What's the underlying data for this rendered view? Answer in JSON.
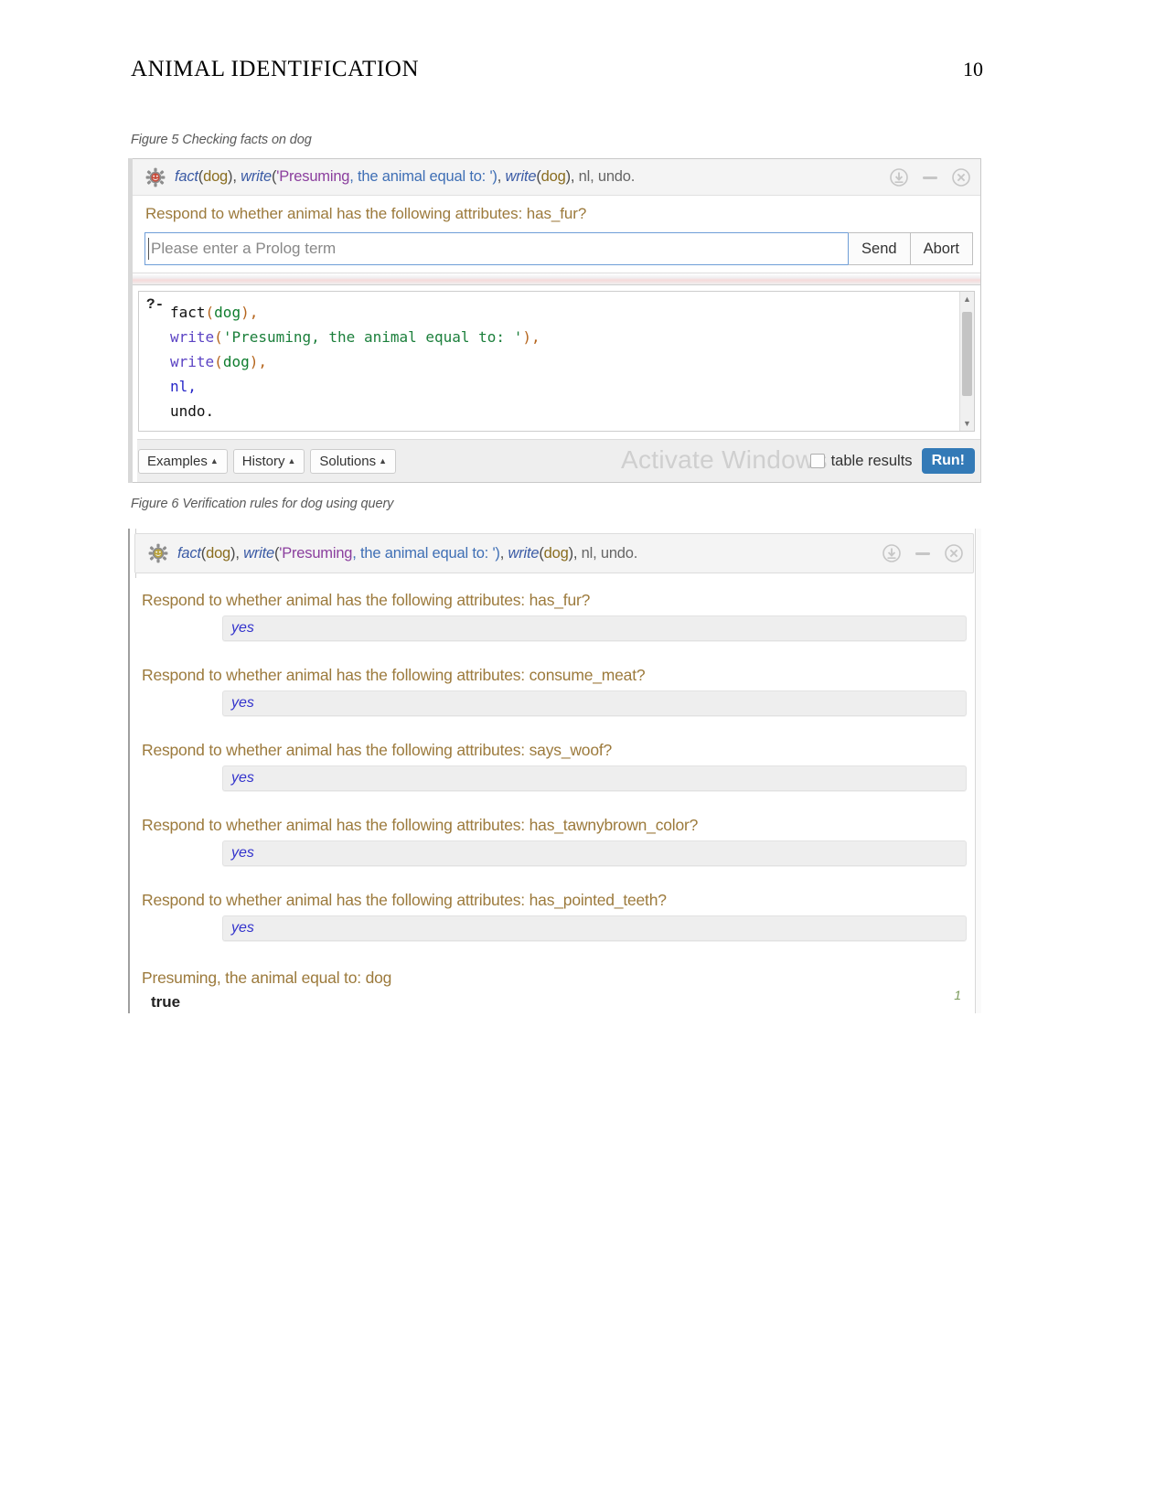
{
  "document": {
    "header_title": "ANIMAL IDENTIFICATION",
    "page_number": "10",
    "caption_fig5": "Figure 5 Checking facts on dog",
    "caption_fig6": "Figure 6 Verification rules for dog using query"
  },
  "query_title": {
    "icon": "swish-gear-icon",
    "p1_func": "fact",
    "p1_open": "(",
    "p1_arg": "dog",
    "p1_close": "), ",
    "p2_func": "write",
    "p2_open": "(",
    "p2_str": "'Presuming",
    "p2_str_rest": ", the animal equal to: ')",
    "p2_close": ", ",
    "p3_func": "write",
    "p3_open": "(",
    "p3_arg": "dog",
    "p3_close": "), ",
    "p4": "nl, undo.",
    "full_text": "fact(dog), write('Presuming, the animal equal to: '), write(dog), nl, undo."
  },
  "window_controls": {
    "download": "download-icon",
    "minimize": "minimize-icon",
    "close": "close-icon"
  },
  "fig5": {
    "ask_line": "Respond to whether animal has the following attributes: has_fur?",
    "input_placeholder": "Please enter a Prolog term",
    "input_value": "",
    "send_label": "Send",
    "abort_label": "Abort",
    "editor": {
      "prompt": "?-",
      "lines": [
        {
          "parts": [
            {
              "t": "fact",
              "c": "plain"
            },
            {
              "t": "(",
              "c": "paren"
            },
            {
              "t": "dog",
              "c": "arg"
            },
            {
              "t": "),",
              "c": "paren"
            }
          ]
        },
        {
          "parts": [
            {
              "t": "write",
              "c": "write"
            },
            {
              "t": "(",
              "c": "paren"
            },
            {
              "t": "'Presuming, the animal equal to: '",
              "c": "str"
            },
            {
              "t": "),",
              "c": "paren"
            }
          ]
        },
        {
          "parts": [
            {
              "t": "write",
              "c": "write"
            },
            {
              "t": "(",
              "c": "paren"
            },
            {
              "t": "dog",
              "c": "arg"
            },
            {
              "t": "),",
              "c": "paren"
            }
          ]
        },
        {
          "parts": [
            {
              "t": "nl",
              "c": "nl"
            },
            {
              "t": ",",
              "c": "plain"
            }
          ]
        },
        {
          "parts": [
            {
              "t": "undo.",
              "c": "plain"
            }
          ]
        }
      ],
      "line1": "fact(dog),",
      "line2": "write('Presuming, the animal equal to: '),",
      "line3": "write(dog),",
      "line4": "nl,",
      "line5": "undo."
    },
    "toolbar": {
      "examples_label": "Examples",
      "history_label": "History",
      "solutions_label": "Solutions",
      "caret": "▲",
      "table_results_label": "table results",
      "table_results_checked": false,
      "run_label": "Run!"
    },
    "watermark": "Activate Windows"
  },
  "fig6": {
    "qa": [
      {
        "question": "Respond to whether animal has the following attributes: has_fur?",
        "answer": "yes"
      },
      {
        "question": "Respond to whether animal has the following attributes: consume_meat?",
        "answer": "yes"
      },
      {
        "question": "Respond to whether animal has the following attributes: says_woof?",
        "answer": "yes"
      },
      {
        "question": "Respond to whether animal has the following attributes: has_tawnybrown_color?",
        "answer": "yes"
      },
      {
        "question": "Respond to whether animal has the following attributes: has_pointed_teeth?",
        "answer": "yes"
      }
    ],
    "conclusion": "Presuming, the animal equal to: dog",
    "status": "true",
    "answer_count": "1"
  },
  "colors": {
    "accent_blue": "#337ab7",
    "prompt_brown": "#9c7a3c",
    "answer_blue": "#3333cc",
    "watermark_gray": "#cfcfcf"
  }
}
